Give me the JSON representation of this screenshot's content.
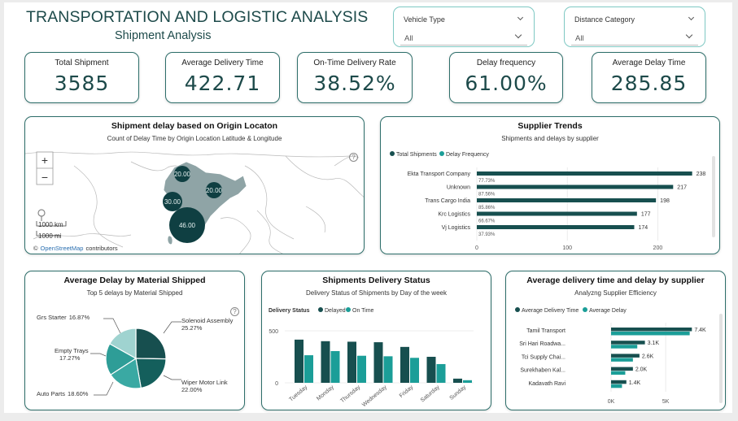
{
  "header": {
    "title": "TRANSPORTATION AND LOGISTIC ANALYSIS",
    "subtitle": "Shipment Analysis"
  },
  "filters": {
    "vehicle_type": {
      "label": "Vehicle Type",
      "value": "All"
    },
    "distance_category": {
      "label": "Distance Category",
      "value": "All"
    }
  },
  "kpis": [
    {
      "label": "Total Shipment",
      "value": "3585"
    },
    {
      "label": "Average Delivery Time",
      "value": "422.71"
    },
    {
      "label": "On-Time Delivery Rate",
      "value": "38.52%"
    },
    {
      "label": "Delay frequency",
      "value": "61.00%"
    },
    {
      "label": "Average Delay Time",
      "value": "285.85"
    }
  ],
  "colors": {
    "dark_teal": "#174f4f",
    "teal": "#1b9e98",
    "light_teal": "#9fd3d0",
    "mid_teal": "#3aa9a3",
    "map_land": "#8fa4a6",
    "bubble": "#0f3f42"
  },
  "map": {
    "title": "Shipment delay based on Origin Locaton",
    "subtitle": "Count of Delay Time by Origin Location Latitude & Longitude",
    "zoom_in": "+",
    "zoom_out": "−",
    "scale_km": "1000 km",
    "scale_mi": "1000 mi",
    "attribution_prefix": "©",
    "attribution_link": "OpenStreetMap",
    "attribution_suffix": "contributors",
    "bubbles": [
      {
        "label": "20.00",
        "value": 20
      },
      {
        "label": "20.00",
        "value": 20
      },
      {
        "label": "30.00",
        "value": 30
      },
      {
        "label": "46.00",
        "value": 46
      }
    ]
  },
  "chart_data": [
    {
      "type": "bar",
      "title": "Supplier Trends",
      "subtitle": "Shipments and delays by supplier",
      "legend_position": "top-left",
      "categories": [
        "Ekta Transport Company",
        "Unknown",
        "Trans Cargo India",
        "Krc Logistics",
        "Vj Logistics"
      ],
      "series": [
        {
          "name": "Total Shipments",
          "values": [
            238,
            217,
            198,
            177,
            174
          ],
          "labels": [
            "238",
            "217",
            "198",
            "177",
            "174"
          ]
        },
        {
          "name": "Delay Frequency",
          "values": [
            0.7773,
            0.8756,
            0.8586,
            0.6667,
            0.3793
          ],
          "labels": [
            "77.73%",
            "87.56%",
            "85.86%",
            "66.67%",
            "37.93%"
          ]
        }
      ],
      "xlim": [
        0,
        250
      ],
      "xticks": [
        "0",
        "100",
        "200"
      ]
    },
    {
      "type": "pie",
      "title": "Average Delay by Material Shipped",
      "subtitle": "Top 5 delays by Material Shipped",
      "slices": [
        {
          "label": "Solenoid Assembly",
          "value": 25.27,
          "pct": "25.27%"
        },
        {
          "label": "Wiper Motor Link",
          "value": 22.0,
          "pct": "22.00%"
        },
        {
          "label": "Auto Parts",
          "value": 18.6,
          "pct": "18.60%"
        },
        {
          "label": "Empty Trays",
          "value": 17.27,
          "pct": "17.27%"
        },
        {
          "label": "Grs Starter",
          "value": 16.87,
          "pct": "16.87%"
        }
      ]
    },
    {
      "type": "bar",
      "title": "Shipments Delivery Status",
      "subtitle": "Delivery Status of Shipments by Day of the week",
      "legend_title": "Delivery Status",
      "legend_position": "top-left",
      "categories": [
        "Tuesday",
        "Monday",
        "Thursday",
        "Wednesday",
        "Friday",
        "Saturday",
        "Sunday"
      ],
      "series": [
        {
          "name": "Delayed",
          "values": [
            415,
            400,
            395,
            390,
            345,
            250,
            40
          ]
        },
        {
          "name": "On Time",
          "values": [
            265,
            305,
            260,
            255,
            240,
            180,
            25
          ]
        }
      ],
      "ylim": [
        0,
        600
      ],
      "yticks": [
        "0",
        "500"
      ]
    },
    {
      "type": "bar",
      "title": "Average delivery time and delay by supplier",
      "subtitle": "Analyzng Supplier Efficiency",
      "legend_position": "top-left",
      "categories": [
        "Tamil Transport",
        "Sri Hari Roadwa...",
        "Tci Supply Chai...",
        "Surekhaben Kal...",
        "Kadavath Ravi"
      ],
      "series": [
        {
          "name": "Average Delivery Time",
          "values": [
            7400,
            3100,
            2600,
            2000,
            1400
          ],
          "labels": [
            "7.4K",
            "3.1K",
            "2.6K",
            "2.0K",
            "1.4K"
          ]
        },
        {
          "name": "Average Delay",
          "values": [
            7200,
            2400,
            2000,
            1300,
            1000
          ]
        }
      ],
      "xlim": [
        0,
        7600
      ],
      "xticks": [
        "0K",
        "5K"
      ]
    }
  ]
}
